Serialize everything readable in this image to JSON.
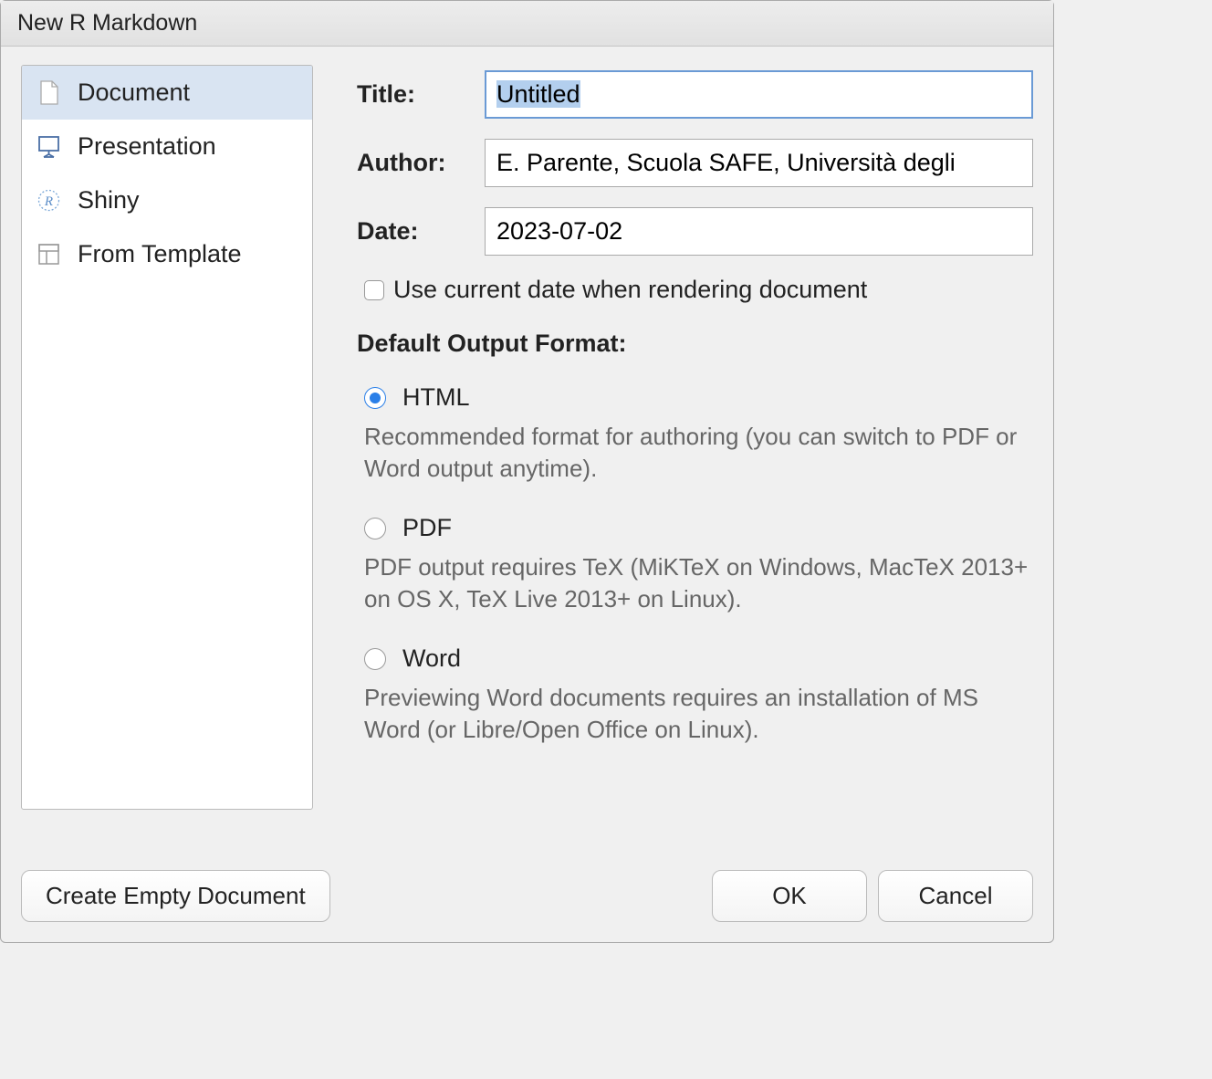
{
  "dialog": {
    "title": "New R Markdown"
  },
  "sidebar": {
    "items": [
      {
        "label": "Document",
        "selected": true
      },
      {
        "label": "Presentation",
        "selected": false
      },
      {
        "label": "Shiny",
        "selected": false
      },
      {
        "label": "From Template",
        "selected": false
      }
    ]
  },
  "form": {
    "title_label": "Title:",
    "title_value": "Untitled",
    "author_label": "Author:",
    "author_value": "E. Parente, Scuola SAFE, Università degli",
    "date_label": "Date:",
    "date_value": "2023-07-02",
    "use_current_date_label": "Use current date when rendering document",
    "use_current_date_checked": false
  },
  "output_format": {
    "heading": "Default Output Format:",
    "options": [
      {
        "label": "HTML",
        "checked": true,
        "description": "Recommended format for authoring (you can switch to PDF or Word output anytime)."
      },
      {
        "label": "PDF",
        "checked": false,
        "description": "PDF output requires TeX (MiKTeX on Windows, MacTeX 2013+ on OS X, TeX Live 2013+ on Linux)."
      },
      {
        "label": "Word",
        "checked": false,
        "description": "Previewing Word documents requires an installation of MS Word (or Libre/Open Office on Linux)."
      }
    ]
  },
  "footer": {
    "create_empty_label": "Create Empty Document",
    "ok_label": "OK",
    "cancel_label": "Cancel"
  }
}
